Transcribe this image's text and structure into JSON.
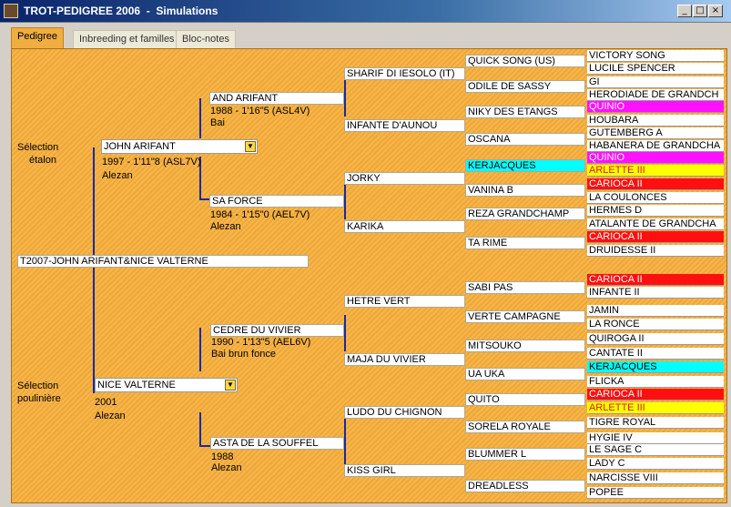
{
  "window": {
    "title": "TROT-PEDIGREE 2006  -  Simulations",
    "btn_min": "_",
    "btn_max": "□",
    "btn_close": "×"
  },
  "tabs": [
    {
      "label": "Pedigree"
    },
    {
      "label": "Inbreeding et familles"
    },
    {
      "label": "Bloc-notes"
    }
  ],
  "colors": {
    "magenta": "#ff10ff",
    "yellow": "#ffff00",
    "red": "#ff1010",
    "cyan": "#00ffff",
    "panel": "#f7af3b",
    "line": "#1a2aa0"
  },
  "foal": {
    "name": "T2007-JOHN ARIFANT&NICE VALTERNE"
  },
  "sire_section": {
    "label_line1": "Sélection",
    "label_line2": "étalon",
    "name": "JOHN ARIFANT",
    "info": "1997 -  1'11\"8 (ASL7V)",
    "color": "Alezan",
    "sire": {
      "name": "AND ARIFANT",
      "info": "1988 -  1'16\"5 (ASL4V)",
      "color": "Bai"
    },
    "dam": {
      "name": "SA FORCE",
      "info": "1984 -  1'15\"0 (AEL7V)",
      "color": "Alezan"
    }
  },
  "dam_section": {
    "label_line1": "Sélection",
    "label_line2": "poulinière",
    "name": "NICE VALTERNE",
    "info": "2001",
    "color": "Alezan",
    "sire": {
      "name": "CEDRE DU VIVIER",
      "info": "1990 -  1'13\"5 (AEL6V)",
      "color": "Bai brun fonce"
    },
    "dam": {
      "name": "ASTA DE LA SOUFFEL",
      "info": "1988",
      "color": "Alezan"
    }
  },
  "gen3": [
    "SHARIF DI IESOLO (IT)",
    "INFANTE D'AUNOU",
    "JORKY",
    "KARIKA",
    "HETRE VERT",
    "MAJA DU VIVIER",
    "LUDO DU CHIGNON",
    "KISS GIRL"
  ],
  "gen4": [
    {
      "name": "QUICK SONG (US)"
    },
    {
      "name": "ODILE DE SASSY"
    },
    {
      "name": "NIKY DES ETANGS"
    },
    {
      "name": "OSCANA"
    },
    {
      "name": "KERJACQUES",
      "hl": "cyan"
    },
    {
      "name": "VANINA B"
    },
    {
      "name": "REZA GRANDCHAMP"
    },
    {
      "name": "TA RIME"
    },
    {
      "name": "SABI PAS"
    },
    {
      "name": "VERTE CAMPAGNE"
    },
    {
      "name": "MITSOUKO"
    },
    {
      "name": "UA UKA"
    },
    {
      "name": "QUITO"
    },
    {
      "name": "SORELA ROYALE"
    },
    {
      "name": "BLUMMER L"
    },
    {
      "name": "DREADLESS"
    }
  ],
  "gen5": [
    {
      "name": "VICTORY SONG"
    },
    {
      "name": "LUCILE SPENCER"
    },
    {
      "name": "GI"
    },
    {
      "name": "HERODIADE DE GRANDCH"
    },
    {
      "name": "QUINIO",
      "hl": "mag"
    },
    {
      "name": "HOUBARA"
    },
    {
      "name": "GUTEMBERG A"
    },
    {
      "name": "HABANERA DE GRANDCHA"
    },
    {
      "name": "QUINIO",
      "hl": "mag"
    },
    {
      "name": "ARLETTE III",
      "hl": "yel"
    },
    {
      "name": "CARIOCA II",
      "hl": "red"
    },
    {
      "name": "LA COULONCES"
    },
    {
      "name": "HERMES D"
    },
    {
      "name": "ATALANTE DE GRANDCHA"
    },
    {
      "name": "CARIOCA II",
      "hl": "red"
    },
    {
      "name": "DRUIDESSE II"
    },
    {
      "name": "CARIOCA II",
      "hl": "red"
    },
    {
      "name": "INFANTE II"
    },
    {
      "name": "JAMIN"
    },
    {
      "name": "LA RONCE"
    },
    {
      "name": "QUIROGA II"
    },
    {
      "name": "CANTATE II"
    },
    {
      "name": "KERJACQUES",
      "hl": "cyan"
    },
    {
      "name": "FLICKA"
    },
    {
      "name": "CARIOCA II",
      "hl": "red"
    },
    {
      "name": "ARLETTE III",
      "hl": "yel"
    },
    {
      "name": "TIGRE ROYAL"
    },
    {
      "name": "HYGIE IV"
    },
    {
      "name": "LE SAGE C"
    },
    {
      "name": "LADY C"
    },
    {
      "name": "NARCISSE VIII"
    },
    {
      "name": "POPEE"
    }
  ]
}
